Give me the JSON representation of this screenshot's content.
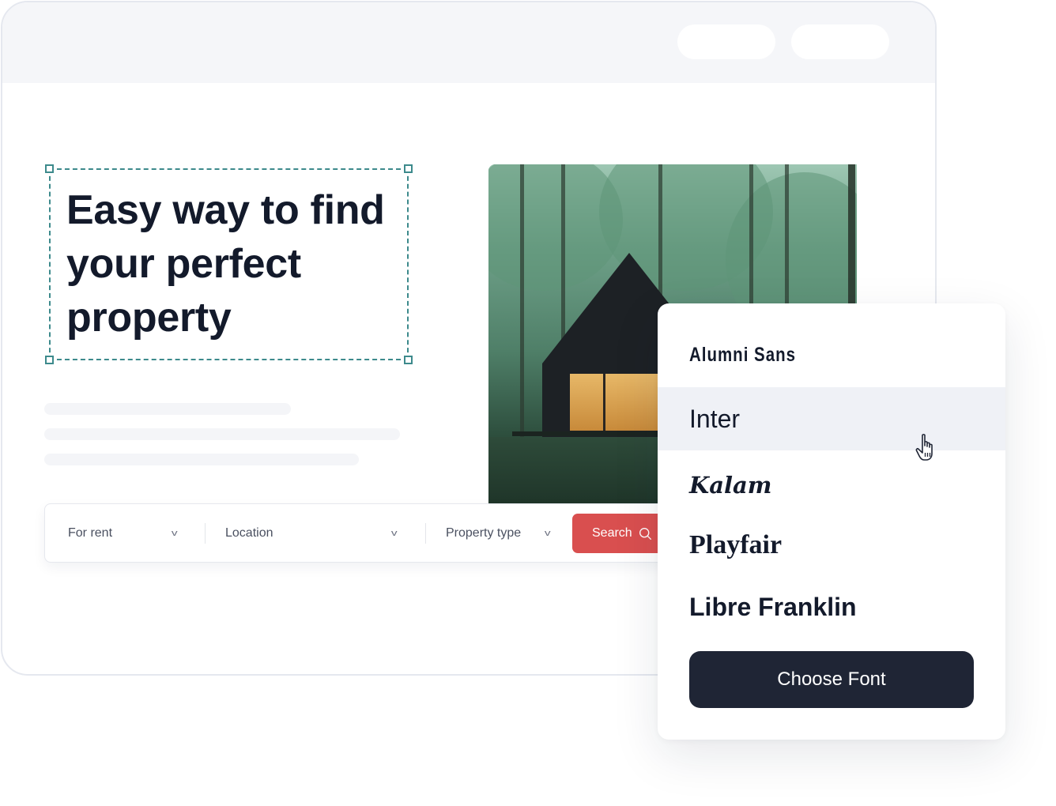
{
  "browser": {
    "bar_buttons": [
      "",
      ""
    ]
  },
  "hero": {
    "headline": "Easy way to find your perfect property",
    "selection_color": "#3d8a8c"
  },
  "photo": {
    "description": "Black A-frame cabin with lit windows in a green forest"
  },
  "search": {
    "listing_type": "For rent",
    "location": "Location",
    "property_type": "Property type",
    "search_label": "Search",
    "accent_color": "#d94f4f"
  },
  "font_picker": {
    "items": [
      {
        "label": "Alumni Sans",
        "hovered": false
      },
      {
        "label": "Inter",
        "hovered": true
      },
      {
        "label": "Kalam",
        "hovered": false
      },
      {
        "label": "Playfair",
        "hovered": false
      },
      {
        "label": "Libre Franklin",
        "hovered": false
      }
    ],
    "choose_label": "Choose Font",
    "button_color": "#1f2535",
    "hover_color": "#eff1f6"
  }
}
